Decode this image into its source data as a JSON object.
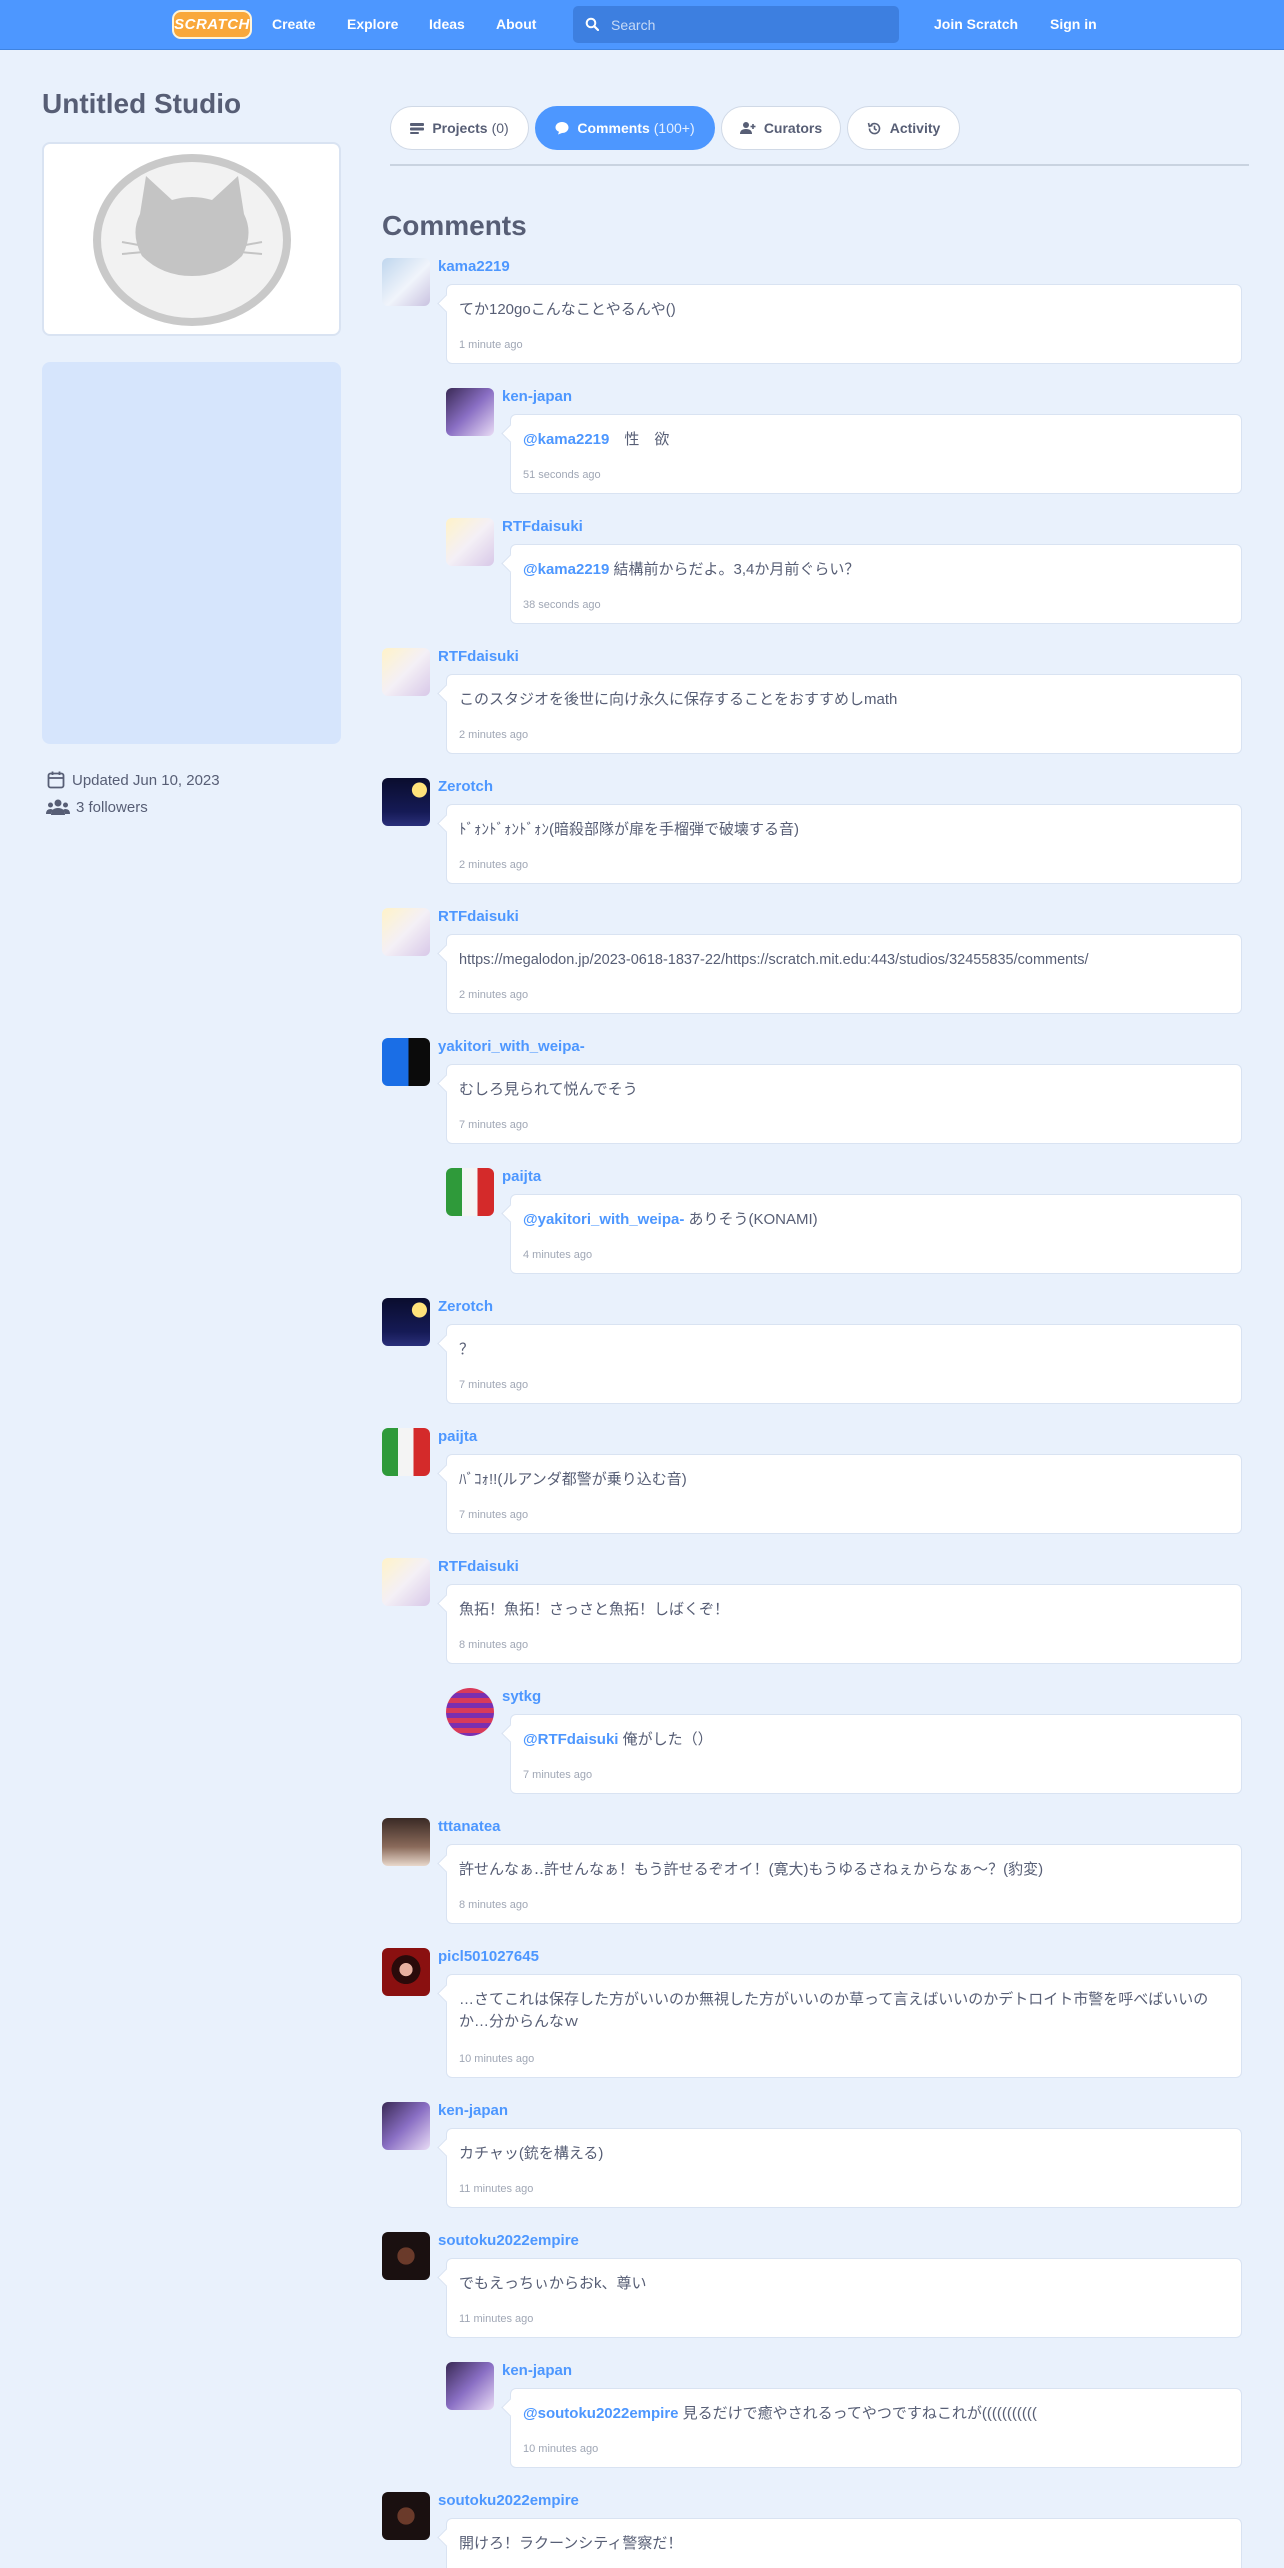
{
  "nav": {
    "logo": "SCRATCH",
    "links": [
      "Create",
      "Explore",
      "Ideas",
      "About"
    ],
    "search_placeholder": "Search",
    "join": "Join Scratch",
    "signin": "Sign in"
  },
  "studio": {
    "title": "Untitled Studio",
    "updated": "Updated Jun 10, 2023",
    "followers": "3 followers"
  },
  "tabs": [
    {
      "label": "Projects",
      "count": "(0)",
      "icon": "projects-icon"
    },
    {
      "label": "Comments",
      "count": "(100+)",
      "icon": "comment-bubble-icon"
    },
    {
      "label": "Curators",
      "count": "",
      "icon": "add-user-icon"
    },
    {
      "label": "Activity",
      "count": "",
      "icon": "history-icon"
    }
  ],
  "comments_heading": "Comments",
  "colors": {
    "accent": "#4d97ff",
    "background": "#e9f1fc",
    "text": "#575e75"
  },
  "comments": [
    {
      "user": "kama2219",
      "text": "てか120goこんなことやるんや()",
      "time": "1 minute ago"
    },
    {
      "user": "ken-japan",
      "mention": "@kama2219",
      "text": "　性　欲",
      "time": "51 seconds ago"
    },
    {
      "user": "RTFdaisuki",
      "mention": "@kama2219",
      "text": " 結構前からだよ。3,4か月前ぐらい？",
      "time": "38 seconds ago"
    },
    {
      "user": "RTFdaisuki",
      "text": "このスタジオを後世に向け永久に保存することをおすすめしmath",
      "time": "2 minutes ago"
    },
    {
      "user": "Zerotch",
      "text": "ﾄﾞｫﾝﾄﾞｫﾝﾄﾞｫﾝ(暗殺部隊が扉を手榴弾で破壊する音)",
      "time": "2 minutes ago"
    },
    {
      "user": "RTFdaisuki",
      "text": "https://megalodon.jp/2023-0618-1837-22/https://scratch.mit.edu:443/studios/32455835/comments/",
      "time": "2 minutes ago"
    },
    {
      "user": "yakitori_with_weipa-",
      "text": "むしろ見られて悦んでそう",
      "time": "7 minutes ago"
    },
    {
      "user": "paijta",
      "mention": "@yakitori_with_weipa-",
      "text": " ありそう(KONAMI)",
      "time": "4 minutes ago"
    },
    {
      "user": "Zerotch",
      "text": "？",
      "time": "7 minutes ago"
    },
    {
      "user": "paijta",
      "text": "ﾊﾞｺｫ!!(ルアンダ都警が乗り込む音)",
      "time": "7 minutes ago"
    },
    {
      "user": "RTFdaisuki",
      "text": "魚拓！魚拓！さっさと魚拓！しばくぞ！",
      "time": "8 minutes ago"
    },
    {
      "user": "sytkg",
      "mention": "@RTFdaisuki",
      "text": " 俺がした（）",
      "time": "7 minutes ago"
    },
    {
      "user": "tttanatea",
      "text": "許せんなぁ‥許せんなぁ！もう許せるぞオイ！(寛大)もうゆるさねぇからなぁ〜？(豹変)",
      "time": "8 minutes ago"
    },
    {
      "user": "picl501027645",
      "text": "…さてこれは保存した方がいいのか無視した方がいいのか草って言えばいいのかデトロイト市警を呼べばいいのか…分からんなｗ",
      "time": "10 minutes ago"
    },
    {
      "user": "ken-japan",
      "text": "カチャッ(銃を構える)",
      "time": "11 minutes ago"
    },
    {
      "user": "soutoku2022empire",
      "text": "でもえっちぃからおk、尊い",
      "time": "11 minutes ago"
    },
    {
      "user": "ken-japan",
      "mention": "@soutoku2022empire",
      "text": " 見るだけで癒やされるってやつですねこれが(((((((((((",
      "time": "10 minutes ago"
    },
    {
      "user": "soutoku2022empire",
      "text": "開けろ！ラクーンシティ警察だ！",
      "time": ""
    }
  ]
}
